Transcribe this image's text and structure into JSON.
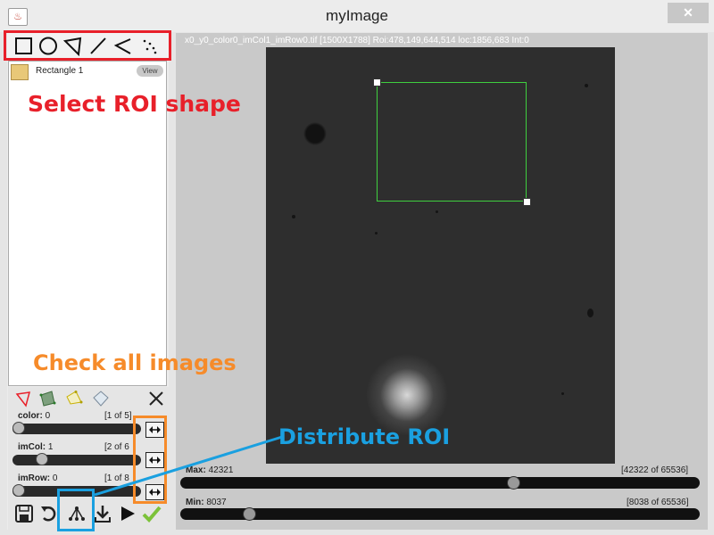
{
  "window": {
    "title": "myImage",
    "close_glyph": "✕",
    "icon": "java-cup-icon"
  },
  "shape_tools": [
    "rectangle-tool",
    "ellipse-tool",
    "polygon-tool",
    "line-tool",
    "polyline-tool",
    "points-tool"
  ],
  "roi_list": [
    {
      "name": "Rectangle 1",
      "view_label": "View"
    }
  ],
  "dimensions": [
    {
      "name": "color:",
      "value": "0",
      "count": "[1 of 5]",
      "fraction": 0.0
    },
    {
      "name": "imCol:",
      "value": "1",
      "count": "[2 of 6",
      "fraction": 0.2
    },
    {
      "name": "imRow:",
      "value": "0",
      "count": "[1 of 8",
      "fraction": 0.0
    }
  ],
  "image": {
    "info": "x0_y0_color0_imCol1_imRow0.tif   [1500X1788]  Roi:478,149,644,514   loc:1856,683   Int:0"
  },
  "max": {
    "label": "Max:",
    "value": "42321",
    "count": "[42322 of 65536]",
    "fraction": 0.646
  },
  "min": {
    "label": "Min:",
    "value": "8037",
    "count": "[8038 of 65536]",
    "fraction": 0.123
  },
  "annotations": {
    "select_roi": "Select ROI shape",
    "check_all": "Check all images",
    "distribute": "Distribute ROI"
  },
  "colors": {
    "red": "#e8202a",
    "orange": "#f68b2a",
    "blue": "#1aa0e0",
    "roi_green": "#3fcf3f"
  }
}
